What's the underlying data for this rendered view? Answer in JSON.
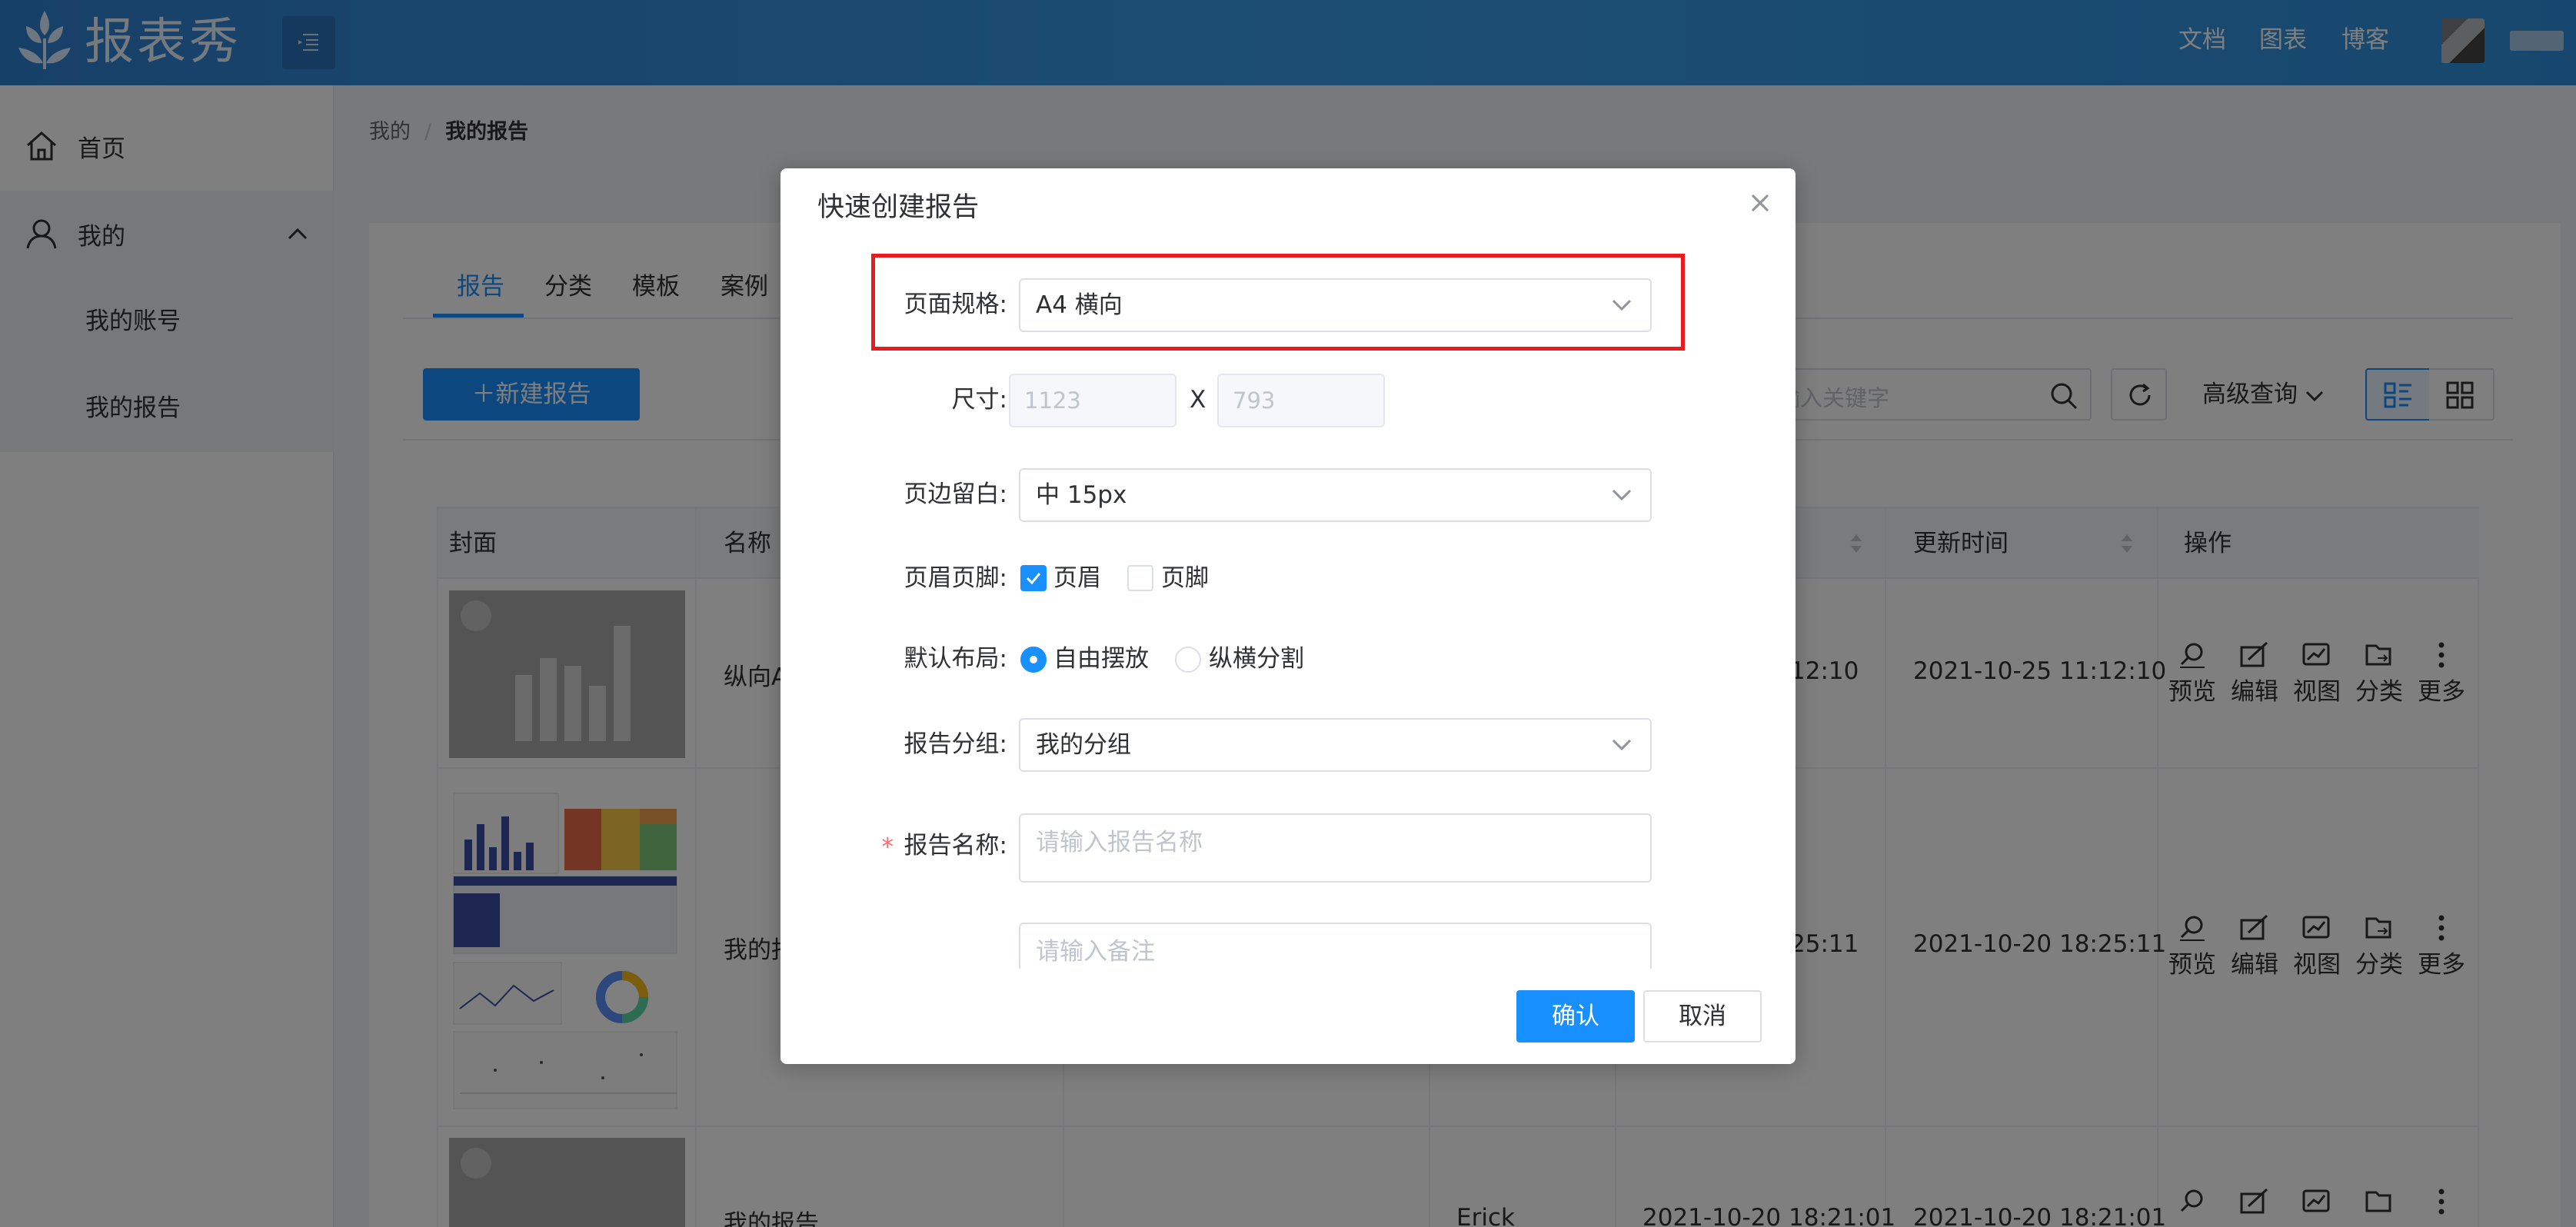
{
  "header": {
    "logo_text": "报表秀",
    "nav": [
      "文档",
      "图表",
      "博客"
    ]
  },
  "sidebar": {
    "home": "首页",
    "mine": "我的",
    "sub_items": [
      "我的账号",
      "我的报告"
    ]
  },
  "breadcrumb": {
    "parent": "我的",
    "separator": "/",
    "current": "我的报告"
  },
  "tabs": [
    "报告",
    "分类",
    "模板",
    "案例"
  ],
  "toolbar": {
    "new_report": "新建报告",
    "search_placeholder": "输入关键字",
    "advanced_query": "高级查询"
  },
  "table": {
    "headers": {
      "cover": "封面",
      "name": "名称",
      "updated": "更新时间",
      "actions": "操作"
    },
    "rows": [
      {
        "name": "纵向A",
        "created_tail": "12:10",
        "updated": "2021-10-25 11:12:10"
      },
      {
        "name": "我的报",
        "created_tail": "25:11",
        "updated": "2021-10-20 18:25:11"
      },
      {
        "name": "我的报告",
        "author": "Erick",
        "created": "2021-10-20 18:21:01",
        "updated": "2021-10-20 18:21:01"
      }
    ],
    "actions": [
      "预览",
      "编辑",
      "视图",
      "分类",
      "更多"
    ]
  },
  "dialog": {
    "title": "快速创建报告",
    "page_spec_label": "页面规格:",
    "page_spec_value": "A4 横向",
    "size_label": "尺寸:",
    "width_placeholder": "1123",
    "size_x": "X",
    "height_placeholder": "793",
    "margin_label": "页边留白:",
    "margin_value": "中 15px",
    "header_footer_label": "页眉页脚:",
    "header_option": "页眉",
    "footer_option": "页脚",
    "layout_label": "默认布局:",
    "layout_free": "自由摆放",
    "layout_split": "纵横分割",
    "group_label": "报告分组:",
    "group_value": "我的分组",
    "required_mark": "*",
    "name_label": "报告名称:",
    "name_placeholder": "请输入报告名称",
    "note_placeholder": "请输入备注",
    "confirm": "确认",
    "cancel": "取消"
  },
  "colors": {
    "primary": "#1890ff",
    "highlight": "#e81c1c",
    "header": "#3a9be6"
  }
}
